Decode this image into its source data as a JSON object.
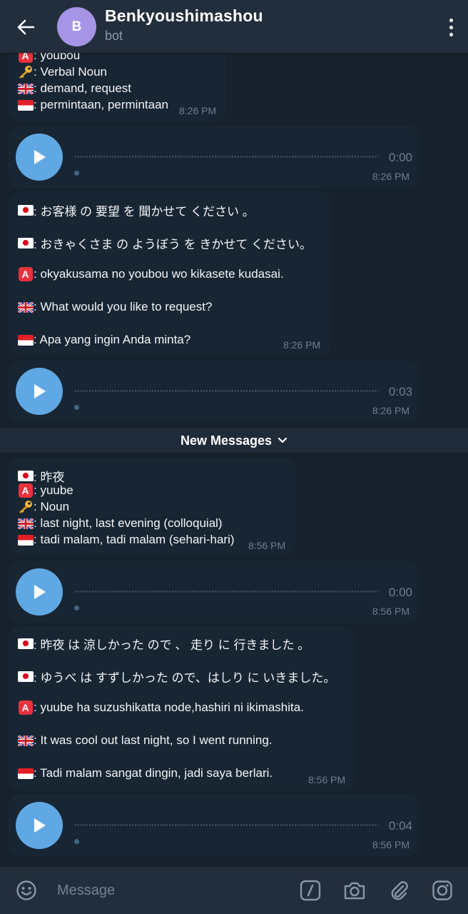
{
  "header": {
    "title": "Benkyoushimashou",
    "subtitle": "bot",
    "avatar_letter": "B",
    "avatar_color": "#a695e7"
  },
  "messages": [
    {
      "kind": "text",
      "lines": [
        {
          "icon": "letter-a-emoji",
          "text": ": youbou"
        },
        {
          "icon": "key-emoji",
          "text": ": Verbal Noun"
        },
        {
          "icon": "uk-flag",
          "text": ": demand, request"
        },
        {
          "icon": "indonesia-flag",
          "text": ": permintaan, permintaan"
        }
      ],
      "time": "8:26 PM"
    },
    {
      "kind": "voice",
      "duration": "0:00",
      "time": "8:26 PM"
    },
    {
      "kind": "text",
      "lines": [
        {
          "icon": "japan-flag",
          "text": ": お客様 の 要望 を 聞かせて ください 。"
        },
        {
          "icon": "japan-flag",
          "text": ": おきゃくさま の ようぼう を きかせて ください。"
        },
        {
          "icon": "letter-a-emoji",
          "text": ": okyakusama no youbou wo kikasete kudasai."
        },
        {
          "icon": "uk-flag",
          "text": ": What would you like to request?"
        },
        {
          "icon": "indonesia-flag",
          "text": ": Apa yang ingin Anda minta?"
        }
      ],
      "time": "8:26 PM"
    },
    {
      "kind": "voice",
      "duration": "0:03",
      "time": "8:26 PM"
    },
    {
      "kind": "text",
      "lines": [
        {
          "icon": "japan-flag",
          "text": ": 昨夜"
        },
        {
          "icon": "letter-a-emoji",
          "text": ": yuube"
        },
        {
          "icon": "key-emoji",
          "text": ": Noun"
        },
        {
          "icon": "uk-flag",
          "text": ": last night, last evening (colloquial)"
        },
        {
          "icon": "indonesia-flag",
          "text": ": tadi malam, tadi malam (sehari-hari)"
        }
      ],
      "time": "8:56 PM"
    },
    {
      "kind": "voice",
      "duration": "0:00",
      "time": "8:56 PM"
    },
    {
      "kind": "text",
      "lines": [
        {
          "icon": "japan-flag",
          "text": ": 昨夜 は 涼しかった ので 、 走り に 行きました 。"
        },
        {
          "icon": "japan-flag",
          "text": ": ゆうべ は すずしかった ので、はしり に いきました。"
        },
        {
          "icon": "letter-a-emoji",
          "text": ": yuube ha suzushikatta node,hashiri ni ikimashita."
        },
        {
          "icon": "uk-flag",
          "text": ": It was cool out last night, so I went running."
        },
        {
          "icon": "indonesia-flag",
          "text": ": Tadi malam sangat dingin, jadi saya berlari."
        }
      ],
      "time": "8:56 PM"
    },
    {
      "kind": "voice",
      "duration": "0:04",
      "time": "8:56 PM"
    }
  ],
  "divider": {
    "label": "New Messages"
  },
  "input": {
    "placeholder": "Message"
  },
  "colors": {
    "background": "#17212b",
    "bubble": "#182533",
    "header": "#232e3c",
    "accent": "#60a8e3",
    "time": "#6c7f92"
  }
}
